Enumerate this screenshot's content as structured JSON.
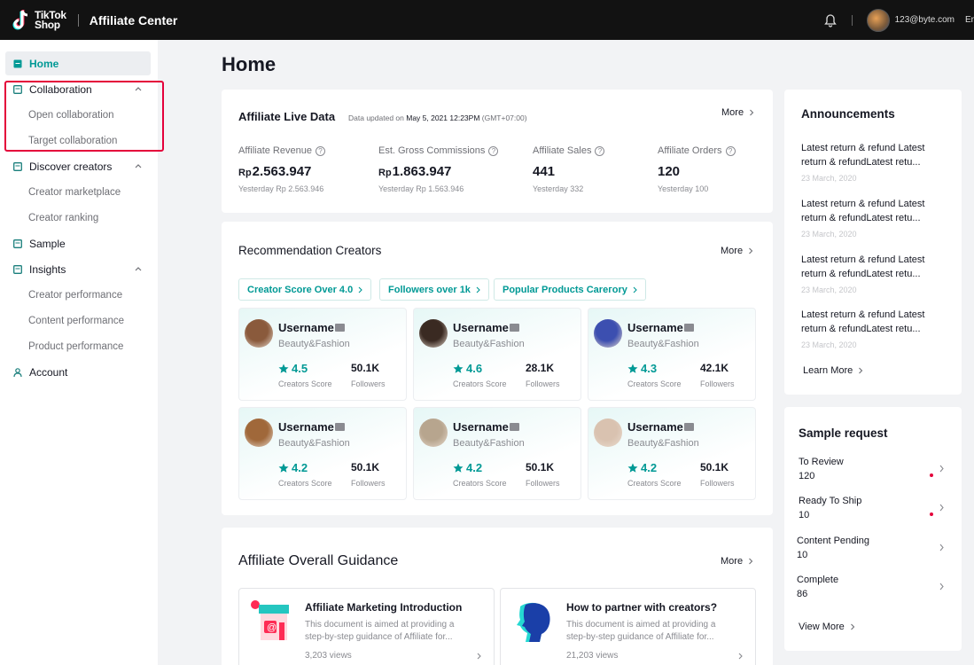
{
  "topbar": {
    "logo_line1": "TikTok",
    "logo_line2": "Shop",
    "app_title": "Affiliate Center",
    "user_email": "123@byte.com",
    "lang": "En"
  },
  "sidebar": {
    "home": "Home",
    "collaboration": "Collaboration",
    "open_collaboration": "Open collaboration",
    "target_collaboration": "Target collaboration",
    "discover_creators": "Discover creators",
    "creator_marketplace": "Creator marketplace",
    "creator_ranking": "Creator ranking",
    "sample": "Sample",
    "insights": "Insights",
    "creator_performance": "Creator performance",
    "content_performance": "Content performance",
    "product_performance": "Product performance",
    "account": "Account"
  },
  "page_title": "Home",
  "live_data": {
    "title": "Affiliate Live Data",
    "updated_prefix": "Data updated on",
    "updated_date": "May 5, 2021 12:23PM",
    "updated_tz": "(GMT+07:00)",
    "more": "More",
    "metrics": [
      {
        "label": "Affiliate Revenue",
        "currency": "Rp",
        "value": "2.563.947",
        "sub": "Yesterday Rp 2.563.946"
      },
      {
        "label": "Est. Gross Commissions",
        "currency": "Rp",
        "value": "1.863.947",
        "sub": "Yesterday Rp 1.563.946"
      },
      {
        "label": "Affiliate Sales",
        "currency": "",
        "value": "441",
        "sub": "Yesterday 332"
      },
      {
        "label": "Affiliate Orders",
        "currency": "",
        "value": "120",
        "sub": "Yesterday 100"
      }
    ]
  },
  "recommendation": {
    "title": "Recommendation Creators",
    "more": "More",
    "filters": [
      "Creator Score Over 4.0",
      "Followers over 1k",
      "Popular Products Carегory"
    ],
    "score_label": "Creators Score",
    "followers_label": "Followers",
    "creators": [
      {
        "name": "Username",
        "category": "Beauty&Fashion",
        "score": "4.5",
        "followers": "50.1K",
        "avatar_color": "#8a5a3c"
      },
      {
        "name": "Username",
        "category": "Beauty&Fashion",
        "score": "4.6",
        "followers": "28.1K",
        "avatar_color": "#3a2a22"
      },
      {
        "name": "Username",
        "category": "Beauty&Fashion",
        "score": "4.3",
        "followers": "42.1K",
        "avatar_color": "#3c4fb0"
      },
      {
        "name": "Username",
        "category": "Beauty&Fashion",
        "score": "4.2",
        "followers": "50.1K",
        "avatar_color": "#a0683a"
      },
      {
        "name": "Username",
        "category": "Beauty&Fashion",
        "score": "4.2",
        "followers": "50.1K",
        "avatar_color": "#b7a58e"
      },
      {
        "name": "Username",
        "category": "Beauty&Fashion",
        "score": "4.2",
        "followers": "50.1K",
        "avatar_color": "#d9c2b0"
      }
    ]
  },
  "guidance": {
    "title": "Affiliate Overall Guidance",
    "more": "More",
    "items": [
      {
        "title": "Affiliate Marketing Introduction",
        "desc": "This document is aimed at providing a step-by-step guidance of Affiliate for...",
        "views": "3,203 views"
      },
      {
        "title": "How to partner with creators?",
        "desc": "This document is aimed at providing a step-by-step guidance of Affiliate for...",
        "views": "21,203 views"
      }
    ]
  },
  "announcements": {
    "title": "Announcements",
    "items": [
      {
        "text": "Latest return & refund Latest return & refundLatest retu...",
        "date": "23 March, 2020"
      },
      {
        "text": "Latest return & refund Latest return & refundLatest retu...",
        "date": "23 March, 2020"
      },
      {
        "text": "Latest return & refund Latest return & refundLatest retu...",
        "date": "23 March, 2020"
      },
      {
        "text": "Latest return & refund Latest return & refundLatest retu...",
        "date": "23 March, 2020"
      }
    ],
    "learn_more": "Learn More"
  },
  "sample_request": {
    "title": "Sample request",
    "items": [
      {
        "label": "To Review",
        "value": "120",
        "alert": true
      },
      {
        "label": "Ready To Ship",
        "value": "10",
        "alert": true
      },
      {
        "label": "Content Pending",
        "value": "10",
        "alert": false
      },
      {
        "label": "Complete",
        "value": "86",
        "alert": false
      }
    ],
    "view_more": "View More"
  },
  "colors": {
    "accent": "#009995",
    "alert": "#e4003a",
    "topbar": "#121212"
  }
}
